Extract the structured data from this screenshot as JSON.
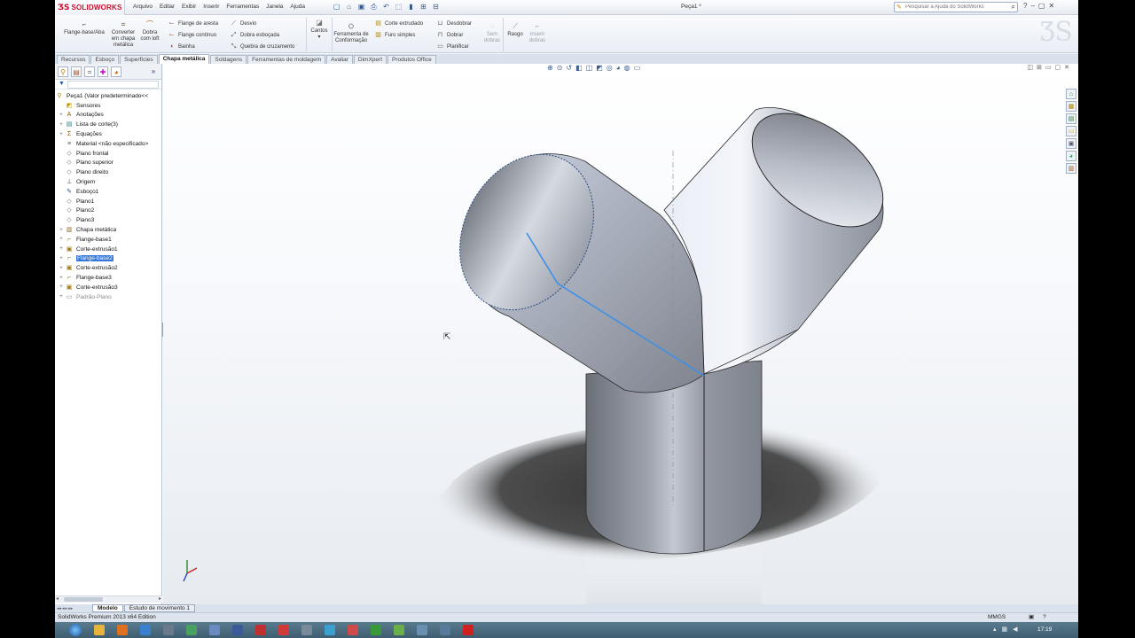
{
  "app": {
    "brand": "SOLIDWORKS",
    "menus": [
      "Arquivo",
      "Editar",
      "Exibir",
      "Inserir",
      "Ferramentas",
      "Janela",
      "Ajuda"
    ],
    "document_title": "Peça1 *",
    "help_search_placeholder": "Pesquisar a Ajuda do SolidWorks"
  },
  "ribbon": {
    "flange_base": "Flange-base/Aba",
    "converter": "Converter em chapa metálica",
    "dobra_loft": "Dobra com loft",
    "flange_aresta": "Flange de aresta",
    "flange_continuo": "Flange contínuo",
    "bainha": "Bainha",
    "desvio": "Desvio",
    "dobra_esbocada": "Dobra esboçada",
    "quebra_cruzamento": "Quebra de cruzamento",
    "cantos": "Cantos",
    "ferramenta_conformacao": "Ferramenta de Conformação",
    "corte_extrudado": "Corte extrudado",
    "furo_simples": "Furo simples",
    "desdobrar": "Desdobrar",
    "dobrar": "Dobrar",
    "planificar": "Planificar",
    "sem_dobras": "Sem dobras",
    "rasgo": "Rasgo",
    "inserir_dobras": "Inserir dobras"
  },
  "tabs": [
    "Recursos",
    "Esboço",
    "Superfícies",
    "Chapa metálica",
    "Soldagens",
    "Ferramentas de moldagem",
    "Avaliar",
    "DimXpert",
    "Produtos Office"
  ],
  "active_tab": "Chapa metálica",
  "feature_tree": [
    {
      "label": "Peça1  (Valor predeterminado<<",
      "icon": "part-icon",
      "expander": ""
    },
    {
      "label": "Sensores",
      "icon": "sensors-icon",
      "expander": ""
    },
    {
      "label": "Anotações",
      "icon": "annotations-icon",
      "expander": "+"
    },
    {
      "label": "Lista de corte(3)",
      "icon": "cut-list-icon",
      "expander": "+"
    },
    {
      "label": "Equações",
      "icon": "equations-icon",
      "expander": "+"
    },
    {
      "label": "Material <não especificado>",
      "icon": "material-icon",
      "expander": ""
    },
    {
      "label": "Plano frontal",
      "icon": "plane-icon",
      "expander": ""
    },
    {
      "label": "Plano superior",
      "icon": "plane-icon",
      "expander": ""
    },
    {
      "label": "Plano direito",
      "icon": "plane-icon",
      "expander": ""
    },
    {
      "label": "Origem",
      "icon": "origin-icon",
      "expander": ""
    },
    {
      "label": "Esboço1",
      "icon": "sketch-icon",
      "expander": ""
    },
    {
      "label": "Plano1",
      "icon": "plane-icon",
      "expander": ""
    },
    {
      "label": "Plano2",
      "icon": "plane-icon",
      "expander": ""
    },
    {
      "label": "Plano3",
      "icon": "plane-icon",
      "expander": ""
    },
    {
      "label": "Chapa metálica",
      "icon": "sheet-metal-icon",
      "expander": "+"
    },
    {
      "label": "Flange-base1",
      "icon": "base-flange-icon",
      "expander": "+"
    },
    {
      "label": "Corte-extrusão1",
      "icon": "cut-extrude-icon",
      "expander": "+"
    },
    {
      "label": "Flange-base2",
      "icon": "base-flange-icon",
      "expander": "+",
      "selected": true
    },
    {
      "label": "Corte-extrusão2",
      "icon": "cut-extrude-icon",
      "expander": "+"
    },
    {
      "label": "Flange-base3",
      "icon": "base-flange-icon",
      "expander": "+"
    },
    {
      "label": "Corte-extrusão3",
      "icon": "cut-extrude-icon",
      "expander": "+"
    },
    {
      "label": "Padrão-Plano",
      "icon": "flat-pattern-icon",
      "expander": "+",
      "grey": true
    }
  ],
  "bottom_tabs": [
    "Modelo",
    "Estudo de movimento 1"
  ],
  "status": {
    "edition": "SolidWorks Premium 2013 x64 Edition",
    "units": "MMGS"
  },
  "taskbar": {
    "clock": "17:19"
  },
  "colors": {
    "brand_red": "#c8102e",
    "selection_blue": "#3778d8",
    "tube_shade": "#8f9399"
  }
}
